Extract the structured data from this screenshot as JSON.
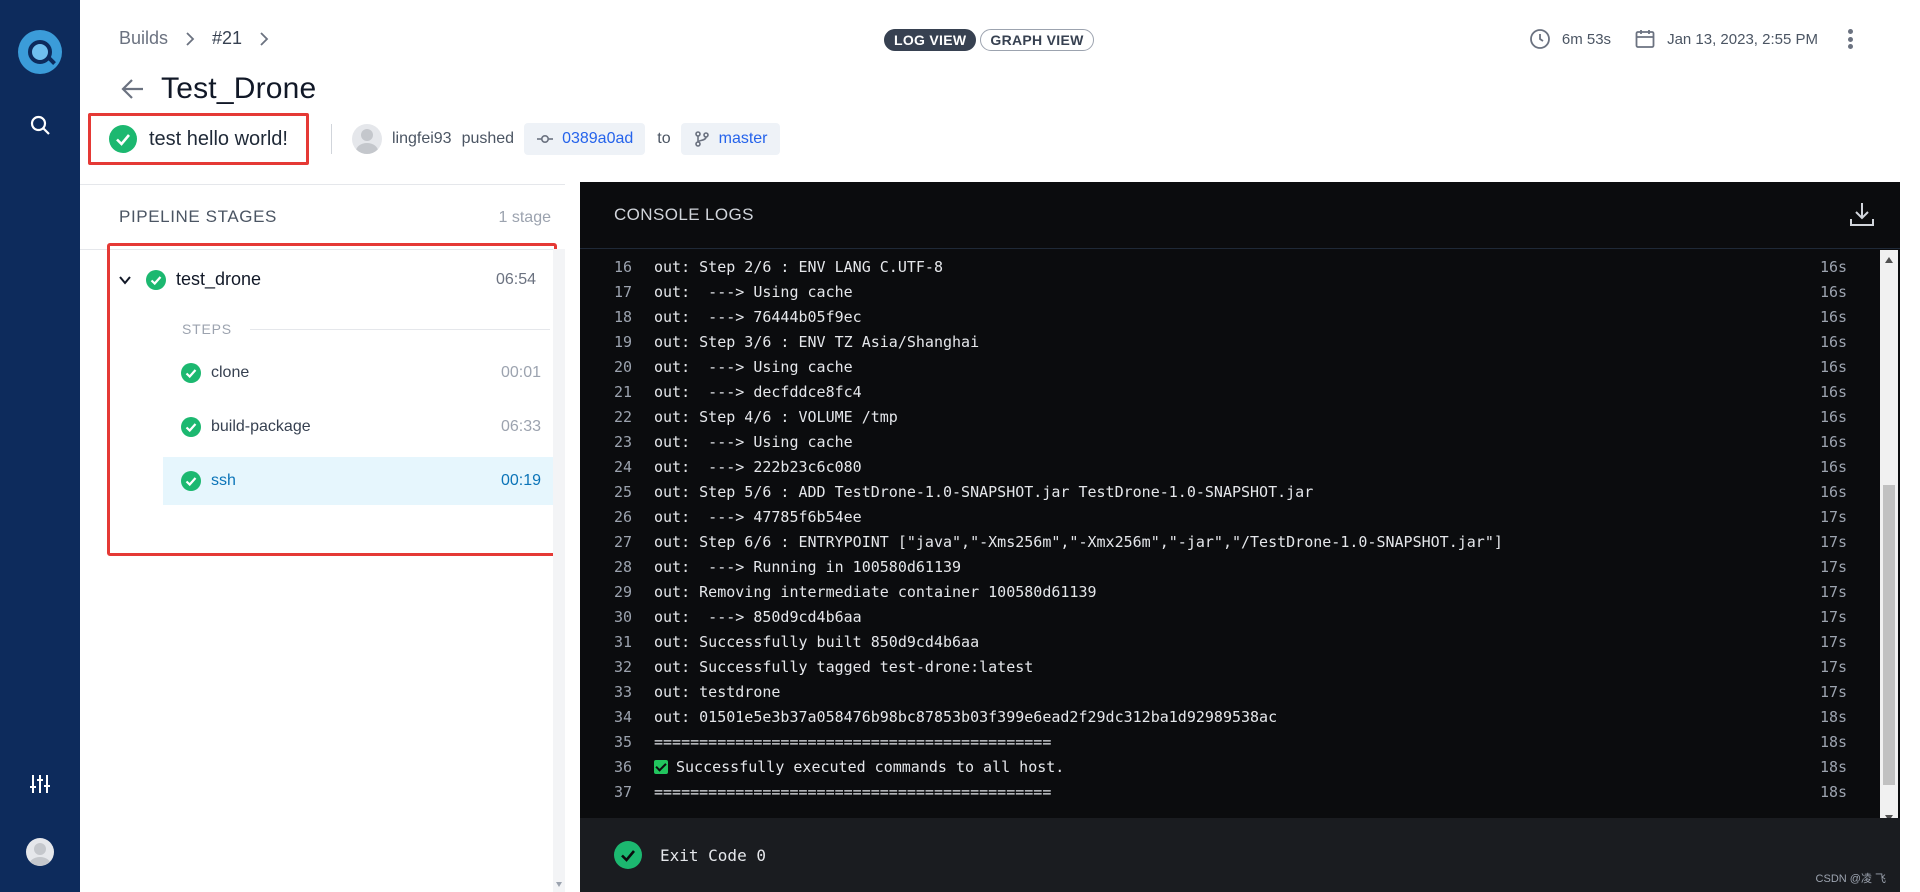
{
  "breadcrumb": {
    "root": "Builds",
    "build": "#21"
  },
  "page": {
    "title": "Test_Drone"
  },
  "views": {
    "log": "LOG VIEW",
    "graph": "GRAPH VIEW"
  },
  "meta": {
    "duration": "6m 53s",
    "date": "Jan 13, 2023, 2:55 PM"
  },
  "commit": {
    "message": "test hello world!",
    "author": "lingfei93",
    "action": "pushed",
    "sha": "0389a0ad",
    "to_label": "to",
    "branch": "master"
  },
  "pipeline": {
    "heading": "PIPELINE STAGES",
    "count": "1 stage",
    "stage": {
      "name": "test_drone",
      "duration": "06:54"
    },
    "steps_label": "STEPS",
    "steps": [
      {
        "name": "clone",
        "duration": "00:01"
      },
      {
        "name": "build-package",
        "duration": "06:33"
      },
      {
        "name": "ssh",
        "duration": "00:19"
      }
    ]
  },
  "console": {
    "heading": "CONSOLE LOGS",
    "lines": [
      {
        "n": "16",
        "text": "out: Step 2/6 : ENV LANG C.UTF-8",
        "t": "16s"
      },
      {
        "n": "17",
        "text": "out:  ---> Using cache",
        "t": "16s"
      },
      {
        "n": "18",
        "text": "out:  ---> 76444b05f9ec",
        "t": "16s"
      },
      {
        "n": "19",
        "text": "out: Step 3/6 : ENV TZ Asia/Shanghai",
        "t": "16s"
      },
      {
        "n": "20",
        "text": "out:  ---> Using cache",
        "t": "16s"
      },
      {
        "n": "21",
        "text": "out:  ---> decfddce8fc4",
        "t": "16s"
      },
      {
        "n": "22",
        "text": "out: Step 4/6 : VOLUME /tmp",
        "t": "16s"
      },
      {
        "n": "23",
        "text": "out:  ---> Using cache",
        "t": "16s"
      },
      {
        "n": "24",
        "text": "out:  ---> 222b23c6c080",
        "t": "16s"
      },
      {
        "n": "25",
        "text": "out: Step 5/6 : ADD TestDrone-1.0-SNAPSHOT.jar TestDrone-1.0-SNAPSHOT.jar",
        "t": "16s"
      },
      {
        "n": "26",
        "text": "out:  ---> 47785f6b54ee",
        "t": "17s"
      },
      {
        "n": "27",
        "text": "out: Step 6/6 : ENTRYPOINT [\"java\",\"-Xms256m\",\"-Xmx256m\",\"-jar\",\"/TestDrone-1.0-SNAPSHOT.jar\"]",
        "t": "17s"
      },
      {
        "n": "28",
        "text": "out:  ---> Running in 100580d61139",
        "t": "17s"
      },
      {
        "n": "29",
        "text": "out: Removing intermediate container 100580d61139",
        "t": "17s"
      },
      {
        "n": "30",
        "text": "out:  ---> 850d9cd4b6aa",
        "t": "17s"
      },
      {
        "n": "31",
        "text": "out: Successfully built 850d9cd4b6aa",
        "t": "17s"
      },
      {
        "n": "32",
        "text": "out: Successfully tagged test-drone:latest",
        "t": "17s"
      },
      {
        "n": "33",
        "text": "out: testdrone",
        "t": "17s"
      },
      {
        "n": "34",
        "text": "out: 01501e5e3b37a058476b98bc87853b03f399e6ead2f29dc312ba1d92989538ac",
        "t": "18s"
      },
      {
        "n": "35",
        "text": "============================================",
        "t": "18s"
      },
      {
        "n": "36",
        "text": "Successfully executed commands to all host.",
        "t": "18s",
        "check": true
      },
      {
        "n": "37",
        "text": "============================================",
        "t": "18s"
      }
    ],
    "exit": "Exit Code 0"
  },
  "watermark": "CSDN @凌 飞",
  "colors": {
    "rail": "#0d2b5c",
    "success": "#1cb870",
    "link": "#2563eb",
    "highlight": "#e53935"
  }
}
